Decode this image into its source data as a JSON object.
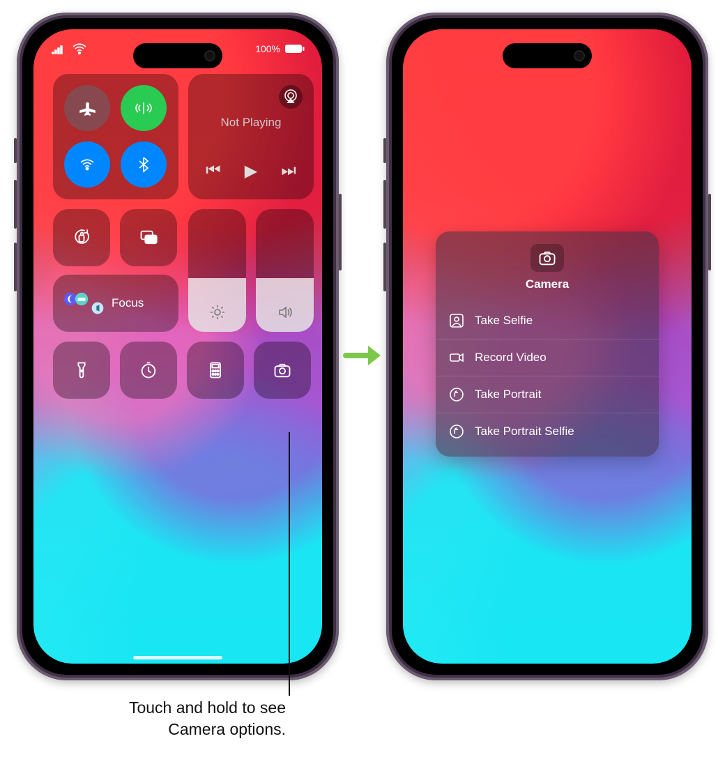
{
  "figure": {
    "battery": "100%",
    "media_status": "Not Playing",
    "focus_label": "Focus",
    "camera_popover_title": "Camera",
    "camera_actions": [
      "Take Selfie",
      "Record Video",
      "Take Portrait",
      "Take Portrait Selfie"
    ],
    "callout": "Touch and hold to see Camera options.",
    "brightness_fill_percent": 44,
    "volume_fill_percent": 44
  }
}
